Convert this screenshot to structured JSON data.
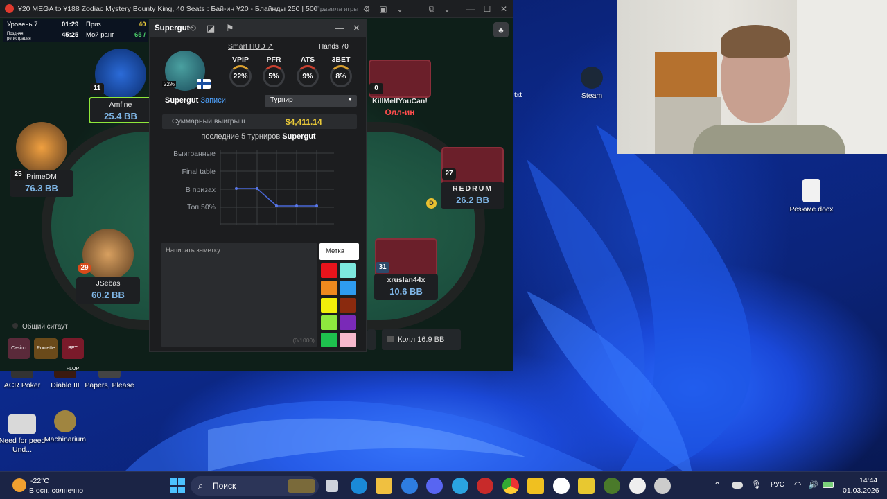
{
  "poker_window": {
    "title": "¥20 MEGA to ¥188 Zodiac Mystery Bounty King, 40 Seats : Бай-ин ¥20 - Блайнды 250 | 500 ...",
    "rules_link": "Правила игры",
    "level_label": "Уровень 7",
    "level_time": "01:29",
    "late_reg_label": "Поздняя регистрация",
    "late_reg_time": "45:25",
    "prize_label": "Приз",
    "prize_value": "40",
    "rank_label": "Мой ранг",
    "rank_value": "65 /",
    "common_sitout": "Общий ситаут",
    "call_button": "Колл 16.9 BB",
    "seats": [
      {
        "name": "Amfine",
        "stack": "25.4 BB",
        "level": "11"
      },
      {
        "name": "PrimeDM",
        "stack": "76.3 BB",
        "level": "25"
      },
      {
        "name": "JSebas",
        "stack": "60.2 BB",
        "level": "29"
      },
      {
        "name": "KillMeIfYouCan!",
        "stack": "Олл-ин",
        "level": "0"
      },
      {
        "name": "REDRUM",
        "stack": "26.2 BB",
        "level": "27"
      },
      {
        "name": "xruslan44x",
        "stack": "10.6 BB",
        "level": "31"
      }
    ],
    "dealer_badge": "D",
    "promo_labels": [
      "Casino",
      "Roulette",
      "BET FLOP"
    ]
  },
  "hud": {
    "player_name": "Supergut",
    "notes_link": "Записи",
    "smart_hud": "Smart HUD",
    "hands": "Hands 70",
    "avatar_pct": "22%",
    "stats": [
      {
        "label": "VPIP",
        "value": "22%"
      },
      {
        "label": "PFR",
        "value": "5%"
      },
      {
        "label": "ATS",
        "value": "9%"
      },
      {
        "label": "3BET",
        "value": "8%"
      }
    ],
    "dropdown_value": "Турнир",
    "total_winnings_label": "Суммарный выигрыш",
    "total_winnings_value": "$4,411.14",
    "last_label_prefix": "последние 5 турниров",
    "last_label_name": "Supergut",
    "graph_rows": [
      "Выигранные",
      "Final table",
      "В призах",
      "Топ 50%"
    ],
    "note_placeholder": "Написать заметку",
    "note_counter": "(0/1000)",
    "tag_label": "Метка",
    "tag_colors": [
      "#e8141c",
      "#7de8de",
      "#f08a1e",
      "#2e9cf0",
      "#f2ee0a",
      "#8a2a0e",
      "#8ee83e",
      "#7a2ab8",
      "#1ec24e",
      "#f6b8cc"
    ]
  },
  "desktop": {
    "icons": [
      {
        "label": "Steam"
      },
      {
        "label": "Резюме.docx"
      },
      {
        "label": "ACR Poker"
      },
      {
        "label": "Diablo III"
      },
      {
        "label": "Papers, Please"
      },
      {
        "label": "Need for peed Und..."
      },
      {
        "label": "Machinarium"
      }
    ],
    "partial_label": "txt"
  },
  "taskbar": {
    "weather_temp": "-22°C",
    "weather_desc": "В осн. солнечно",
    "search_label": "Поиск",
    "lang": "РУС",
    "time": "14:44",
    "date": "01.03.2026"
  }
}
